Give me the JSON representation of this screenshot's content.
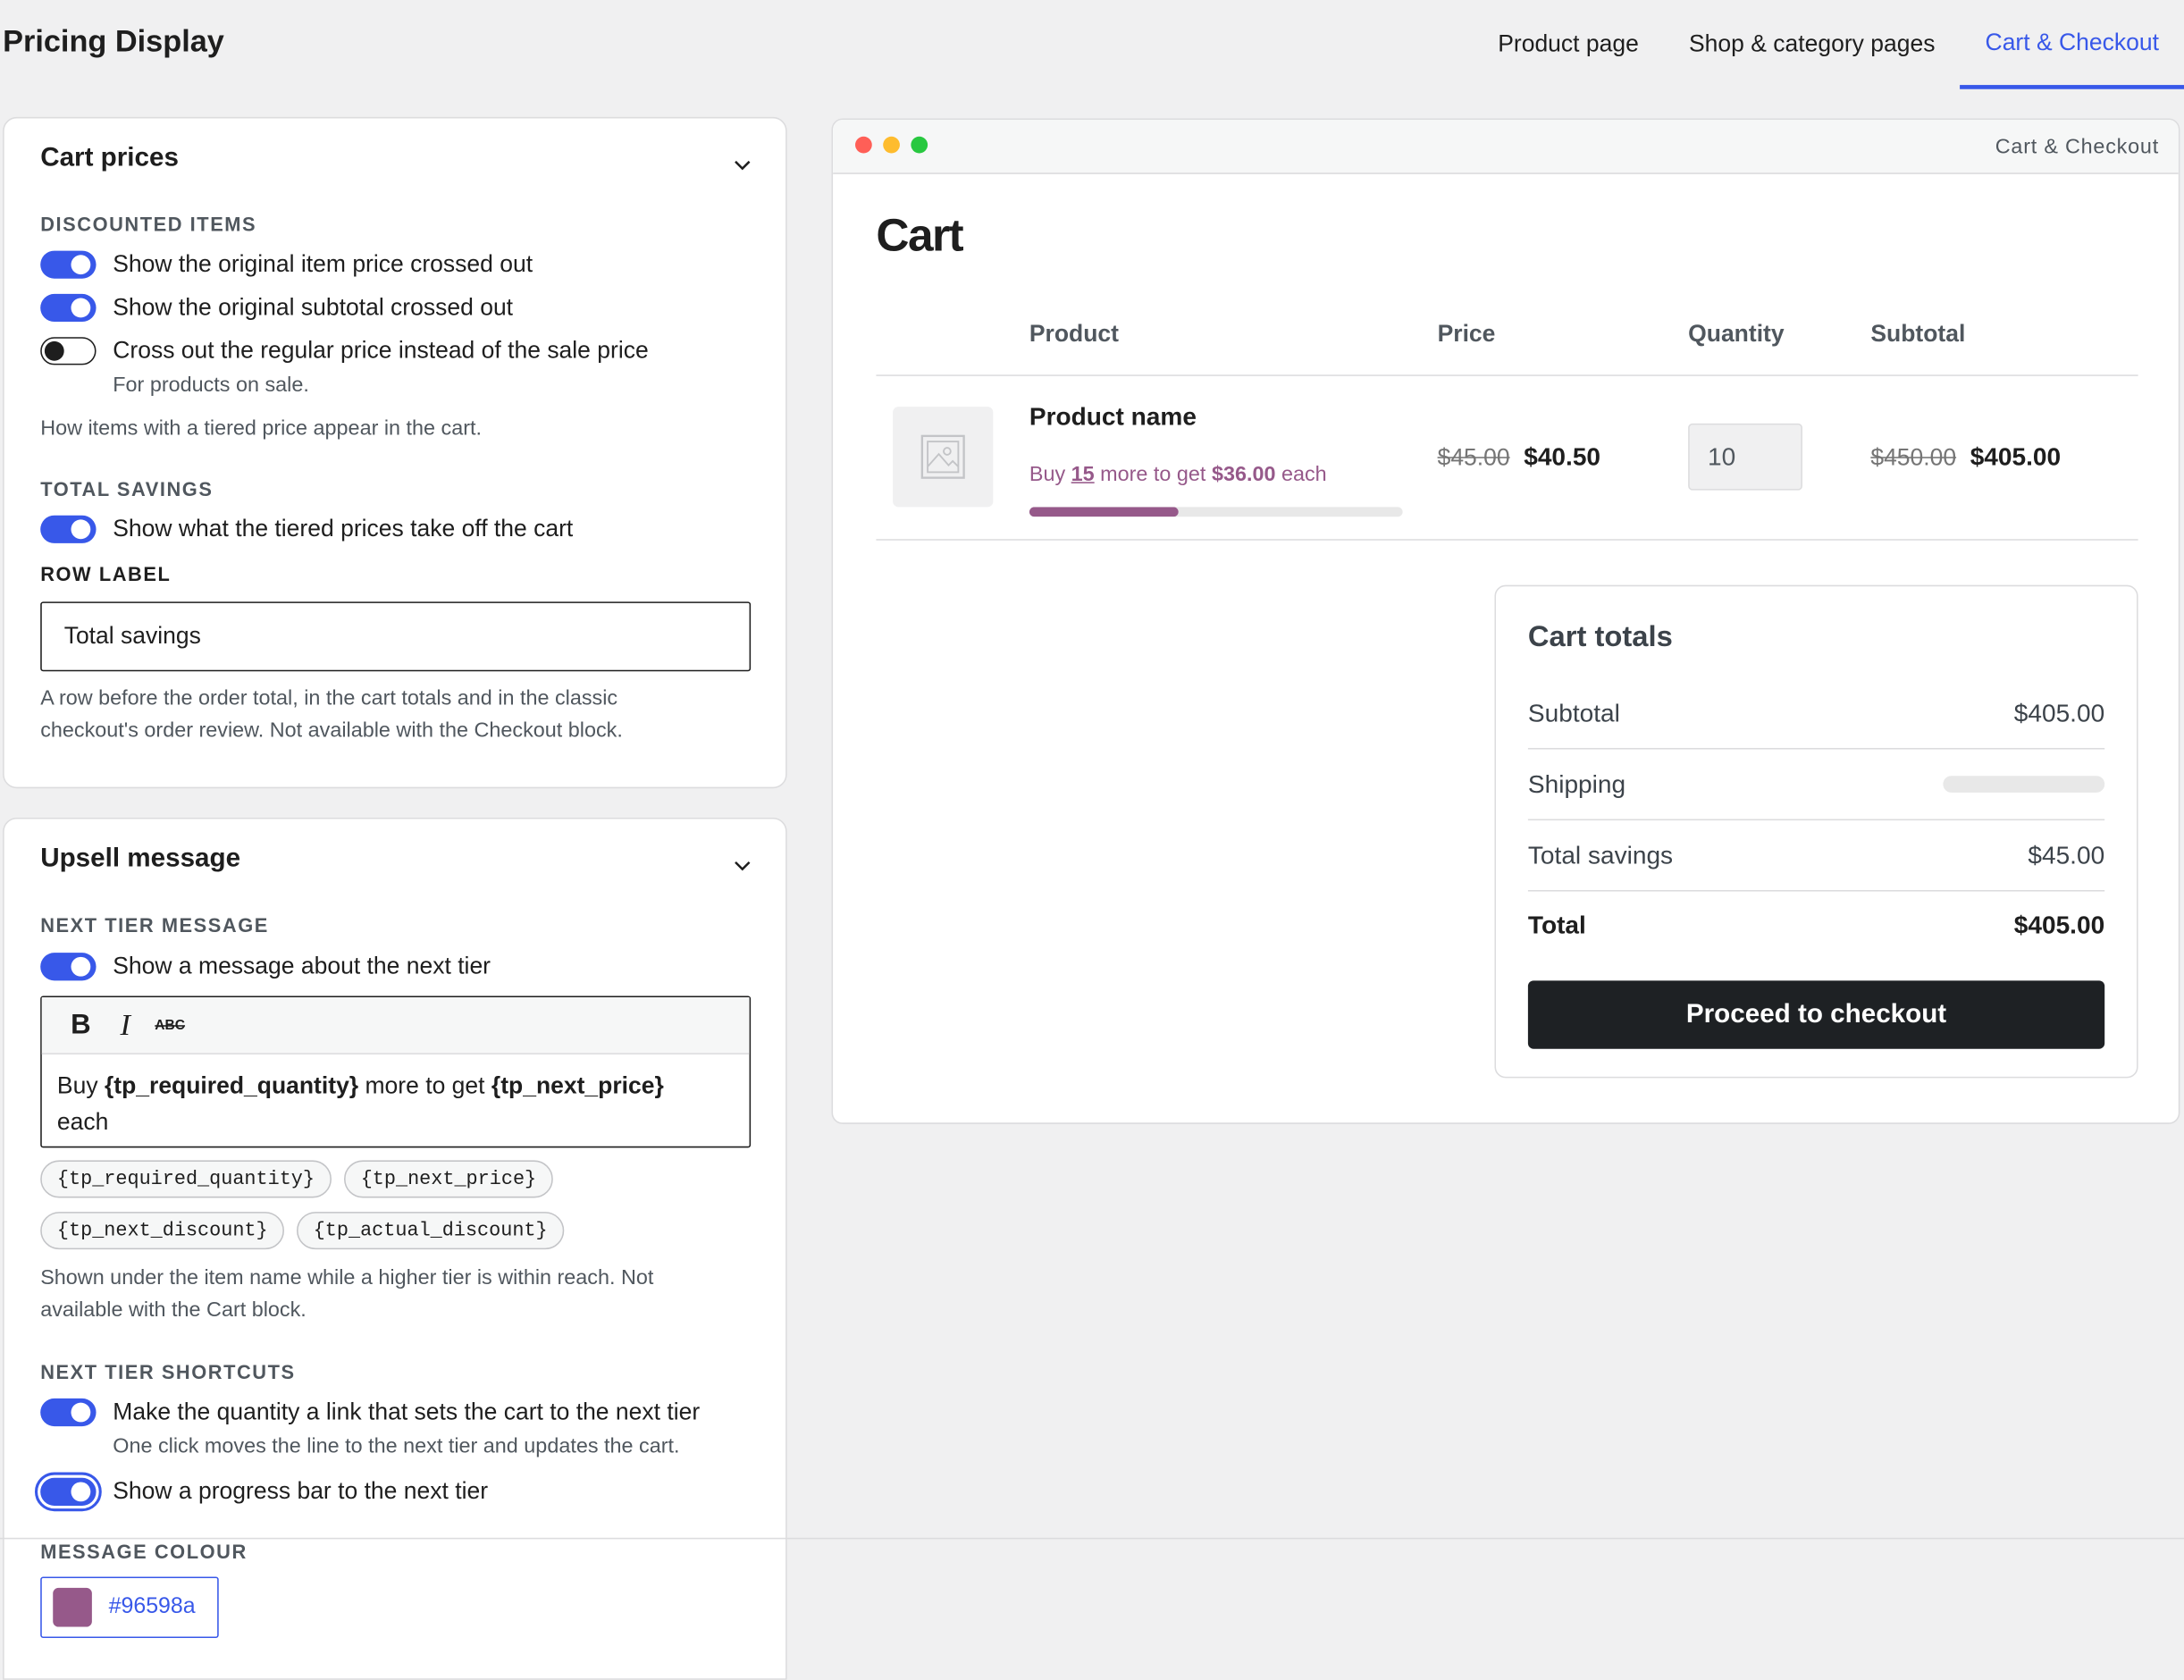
{
  "header": {
    "title": "Pricing Display",
    "tabs": [
      {
        "label": "Product page",
        "active": false
      },
      {
        "label": "Shop & category pages",
        "active": false
      },
      {
        "label": "Cart & Checkout",
        "active": true
      }
    ]
  },
  "cart_prices": {
    "title": "Cart prices",
    "discounted_items_label": "DISCOUNTED ITEMS",
    "toggles": [
      {
        "label": "Show the original item price crossed out",
        "on": true
      },
      {
        "label": "Show the original subtotal crossed out",
        "on": true
      },
      {
        "label": "Cross out the regular price instead of the sale price",
        "on": false,
        "help": "For products on sale."
      }
    ],
    "section_help": "How items with a tiered price appear in the cart.",
    "total_savings_label": "TOTAL SAVINGS",
    "total_savings_toggle": {
      "label": "Show what the tiered prices take off the cart",
      "on": true
    },
    "row_label_label": "ROW LABEL",
    "row_label_value": "Total savings",
    "row_label_help_1": "A row before the order total, in the cart totals and in the classic",
    "row_label_help_2": "checkout's order review. Not available with the Checkout block."
  },
  "upsell": {
    "title": "Upsell message",
    "next_tier_label": "NEXT TIER MESSAGE",
    "next_tier_toggle": {
      "label": "Show a message about the next tier",
      "on": true
    },
    "editor": {
      "bold_label": "B",
      "italic_label": "I",
      "strike_label": "ABC",
      "text_1": "Buy ",
      "token_1": "{tp_required_quantity}",
      "text_2": " more to get ",
      "token_2": "{tp_next_price}",
      "text_3": "each"
    },
    "chips": [
      "{tp_required_quantity}",
      "{tp_next_price}",
      "{tp_next_discount}",
      "{tp_actual_discount}"
    ],
    "editor_help_1": "Shown under the item name while a higher tier is within reach. Not",
    "editor_help_2": "available with the Cart block.",
    "shortcuts_label": "NEXT TIER SHORTCUTS",
    "shortcut_toggles": [
      {
        "label": "Make the quantity a link that sets the cart to the next tier",
        "on": true,
        "help": "One click moves the line to the next tier and updates the cart."
      },
      {
        "label": "Show a progress bar to the next tier",
        "on": true
      }
    ],
    "colour_label": "MESSAGE COLOUR",
    "colour_value": "#96598a"
  },
  "preview": {
    "window_title": "Cart & Checkout",
    "cart_title": "Cart",
    "columns": {
      "product": "Product",
      "price": "Price",
      "quantity": "Quantity",
      "subtotal": "Subtotal"
    },
    "item": {
      "name": "Product name",
      "upsell_pre": "Buy ",
      "upsell_qty": "15",
      "upsell_mid": " more to get ",
      "upsell_price": "$36.00",
      "upsell_post": " each",
      "progress": 0.4,
      "price_old": "$45.00",
      "price_new": "$40.50",
      "quantity": "10",
      "subtotal_old": "$450.00",
      "subtotal_new": "$405.00"
    },
    "totals": {
      "title": "Cart totals",
      "subtotal_label": "Subtotal",
      "subtotal_value": "$405.00",
      "shipping_label": "Shipping",
      "savings_label": "Total savings",
      "savings_value": "$45.00",
      "total_label": "Total",
      "total_value": "$405.00",
      "checkout_label": "Proceed to checkout"
    }
  },
  "colors": {
    "accent": "#3858e9",
    "message": "#96598a"
  }
}
